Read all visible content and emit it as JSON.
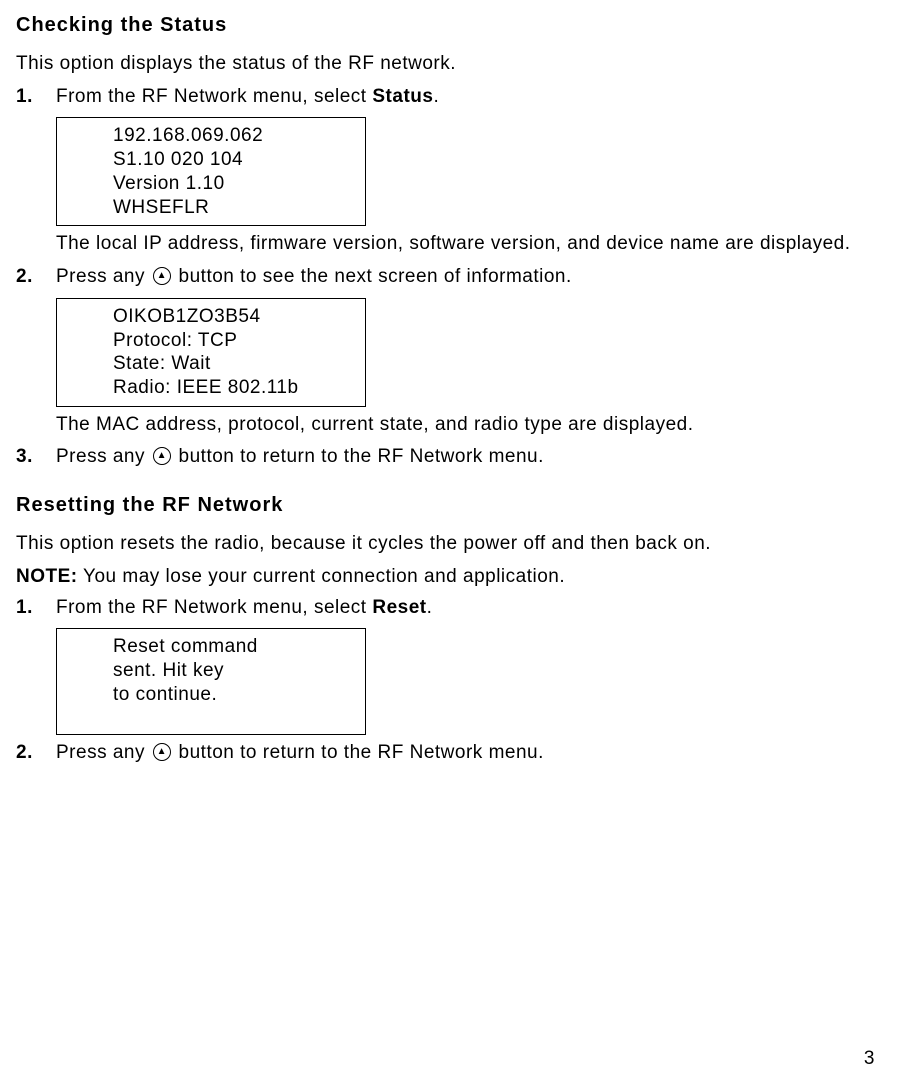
{
  "section1": {
    "heading": "Checking the Status",
    "intro": "This option displays the status of the RF network.",
    "steps": {
      "s1": {
        "num": "1.",
        "text_before": "From the RF Network menu, select ",
        "bold": "Status",
        "text_after": ".",
        "screen": {
          "l1": "192.168.069.062",
          "l2": "S1.10 020 104",
          "l3": "Version 1.10",
          "l4": "WHSEFLR"
        },
        "after": "The local IP address, firmware version, software version, and device name are displayed."
      },
      "s2": {
        "num": "2.",
        "text_before": "Press any ",
        "text_after": " button to see the next screen of information.",
        "screen": {
          "l1": "OIKOB1ZO3B54",
          "l2": "Protocol:  TCP",
          "l3": "State:  Wait",
          "l4": "Radio:  IEEE 802.11b"
        },
        "after": "The MAC address, protocol, current state, and radio type are displayed."
      },
      "s3": {
        "num": "3.",
        "text_before": "Press any ",
        "text_after": " button to return to the RF Network menu."
      }
    }
  },
  "section2": {
    "heading": "Resetting the RF Network",
    "intro": "This option resets the radio, because it cycles the power off and then back on.",
    "note_label": "NOTE:",
    "note_text": "  You may lose your current connection and application.",
    "steps": {
      "s1": {
        "num": "1.",
        "text_before": "From the RF Network menu, select ",
        "bold": "Reset",
        "text_after": ".",
        "screen": {
          "l1": "Reset command",
          "l2": "sent.  Hit key",
          "l3": "to continue."
        }
      },
      "s2": {
        "num": "2.",
        "text_before": "Press any ",
        "text_after": " button to return to the RF Network menu."
      }
    }
  },
  "page_number": "3"
}
